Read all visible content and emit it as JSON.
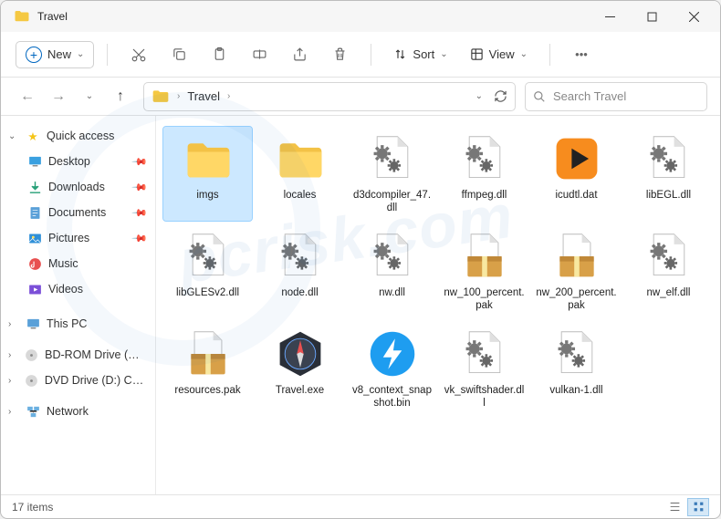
{
  "window": {
    "title": "Travel"
  },
  "toolbar": {
    "new_label": "New",
    "sort_label": "Sort",
    "view_label": "View"
  },
  "address": {
    "segments": [
      "Travel"
    ]
  },
  "search": {
    "placeholder": "Search Travel"
  },
  "nav": {
    "quick_access": "Quick access",
    "items": [
      {
        "label": "Desktop",
        "icon": "desktop"
      },
      {
        "label": "Downloads",
        "icon": "downloads"
      },
      {
        "label": "Documents",
        "icon": "documents"
      },
      {
        "label": "Pictures",
        "icon": "pictures"
      },
      {
        "label": "Music",
        "icon": "music"
      },
      {
        "label": "Videos",
        "icon": "videos"
      }
    ],
    "this_pc": "This PC",
    "drives": [
      {
        "label": "BD-ROM Drive (E:) C"
      },
      {
        "label": "DVD Drive (D:) CCCC"
      }
    ],
    "network": "Network"
  },
  "files": [
    {
      "name": "imgs",
      "type": "folder",
      "selected": true
    },
    {
      "name": "locales",
      "type": "folder"
    },
    {
      "name": "d3dcompiler_47.dll",
      "type": "dll"
    },
    {
      "name": "ffmpeg.dll",
      "type": "dll"
    },
    {
      "name": "icudtl.dat",
      "type": "dat"
    },
    {
      "name": "libEGL.dll",
      "type": "dll"
    },
    {
      "name": "libGLESv2.dll",
      "type": "dll"
    },
    {
      "name": "node.dll",
      "type": "dll"
    },
    {
      "name": "nw.dll",
      "type": "dll"
    },
    {
      "name": "nw_100_percent.pak",
      "type": "pak"
    },
    {
      "name": "nw_200_percent.pak",
      "type": "pak"
    },
    {
      "name": "nw_elf.dll",
      "type": "dll"
    },
    {
      "name": "resources.pak",
      "type": "pak"
    },
    {
      "name": "Travel.exe",
      "type": "exe-compass"
    },
    {
      "name": "v8_context_snapshot.bin",
      "type": "bin"
    },
    {
      "name": "vk_swiftshader.dll",
      "type": "dll"
    },
    {
      "name": "vulkan-1.dll",
      "type": "dll"
    }
  ],
  "status": {
    "count_label": "17 items"
  }
}
